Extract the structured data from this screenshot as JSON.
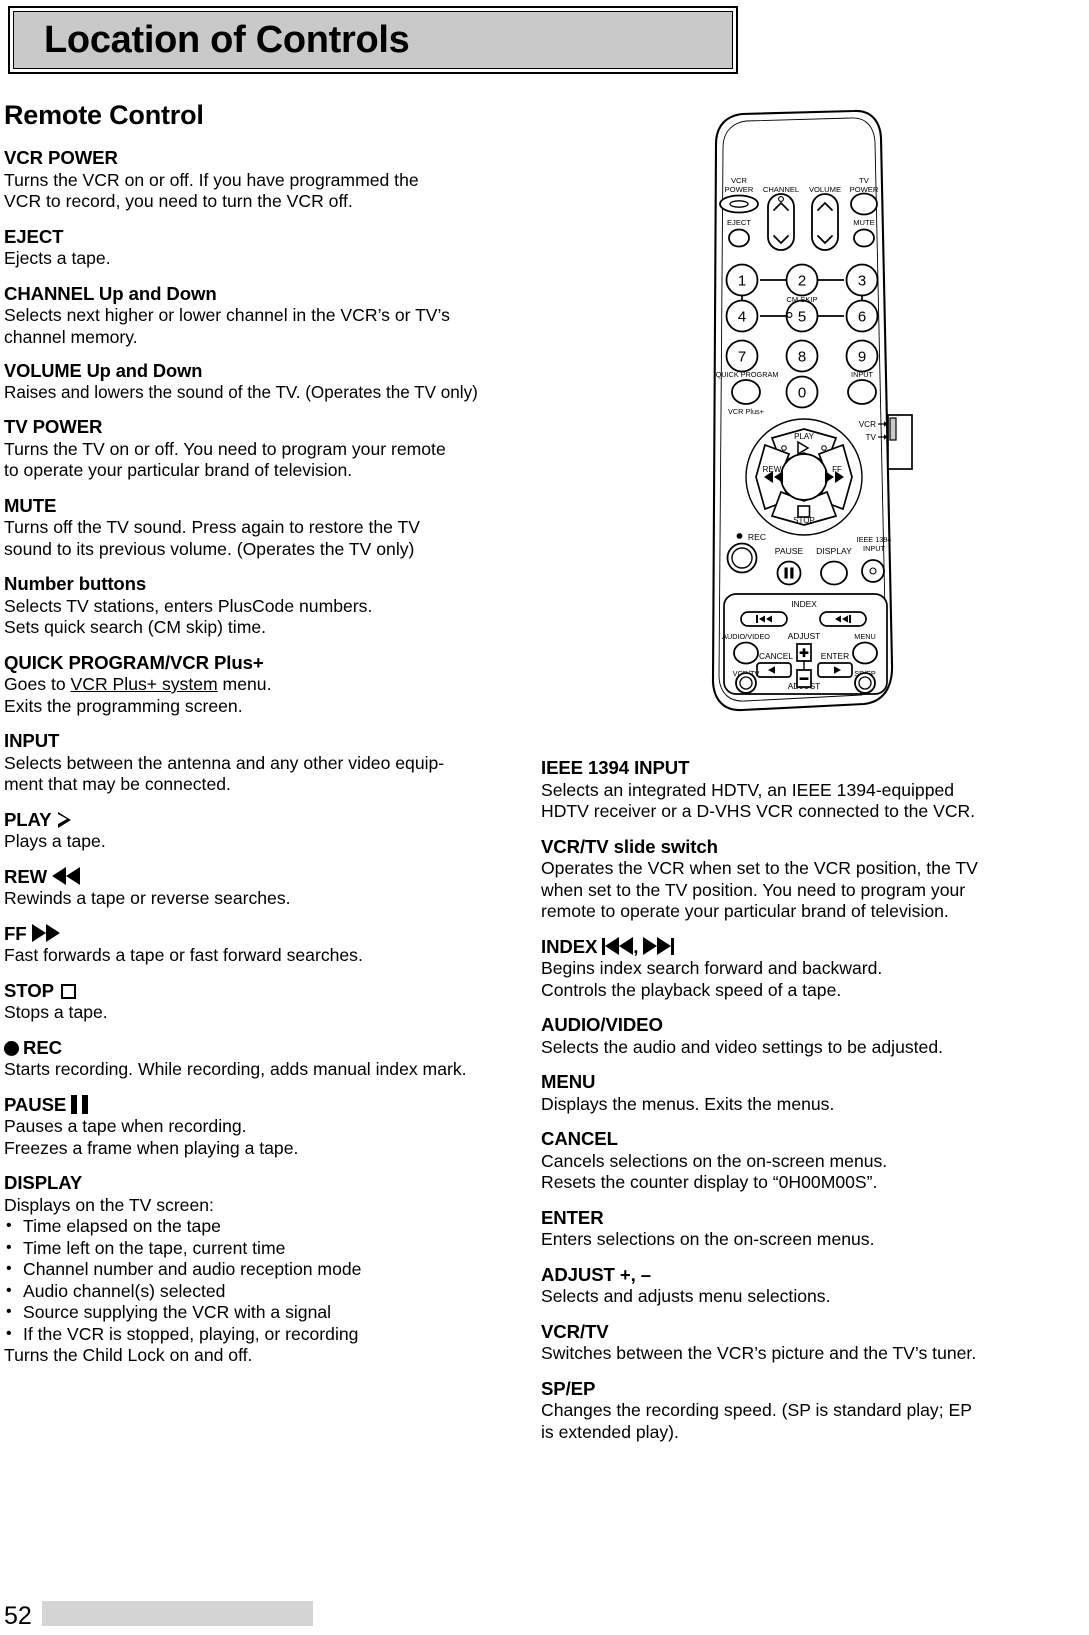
{
  "page": {
    "title": "Location of Controls",
    "section_heading": "Remote Control",
    "page_number": "52"
  },
  "left_column": [
    {
      "title": "VCR POWER",
      "lines": [
        "Turns the VCR on or off.  If you have programmed the",
        "VCR to record, you need to turn the VCR off."
      ]
    },
    {
      "title": "EJECT",
      "lines": [
        "Ejects a tape."
      ]
    },
    {
      "title": "CHANNEL Up and Down",
      "lines": [
        "Selects next higher or lower channel in the VCR’s or TV’s",
        "channel memory."
      ]
    },
    {
      "title": "VOLUME Up and Down",
      "lines": [
        "Raises and lowers the sound of the TV.  (Operates the TV only)"
      ]
    },
    {
      "title": "TV POWER",
      "lines": [
        "Turns the TV on or off.  You need to program your remote",
        "to operate your particular brand of television."
      ]
    },
    {
      "title": "MUTE",
      "lines": [
        "Turns off the TV sound.  Press again to restore the TV",
        "sound to its previous volume.  (Operates the TV only)"
      ]
    },
    {
      "title": "Number buttons",
      "lines": [
        "Selects TV stations, enters PlusCode numbers.",
        "Sets quick search (CM skip) time."
      ]
    },
    {
      "title": "QUICK PROGRAM/VCR Plus+",
      "lines_pre": "Goes to ",
      "lines_underlined": "VCR Plus+ system",
      "lines_post": " menu.",
      "lines": [
        "Exits the programming screen."
      ]
    },
    {
      "title": "INPUT",
      "lines": [
        "Selects between the antenna and any other video equip-",
        "ment that may be connected."
      ]
    },
    {
      "title": "PLAY",
      "icon": "play-triangle-outline-icon",
      "lines": [
        "Plays a tape."
      ]
    },
    {
      "title": "REW",
      "icon": "rewind-double-left-triangle-icon",
      "lines": [
        "Rewinds a tape or reverse searches."
      ]
    },
    {
      "title": "FF",
      "icon": "fast-forward-double-right-triangle-icon",
      "lines": [
        "Fast forwards a tape or fast forward searches."
      ]
    },
    {
      "title": "STOP",
      "icon": "stop-square-outline-icon",
      "lines": [
        "Stops a tape."
      ]
    },
    {
      "title": "REC",
      "icon": "record-filled-circle-icon",
      "icon_position": "before",
      "lines": [
        "Starts recording.  While recording, adds manual index mark."
      ]
    },
    {
      "title": "PAUSE",
      "icon": "pause-double-bar-icon",
      "lines": [
        "Pauses a tape when recording.",
        "Freezes a frame when playing a tape."
      ]
    },
    {
      "title": "DISPLAY",
      "lines": [
        "Displays on the TV screen:"
      ],
      "bullets": [
        "Time elapsed on the tape",
        "Time left on the tape, current time",
        "Channel number and audio reception mode",
        "Audio channel(s) selected",
        "Source supplying the VCR with a signal",
        "If the VCR is stopped, playing, or recording"
      ],
      "lines_after": [
        "Turns the Child Lock on and off."
      ]
    }
  ],
  "right_column": [
    {
      "title": "IEEE 1394 INPUT",
      "lines": [
        "Selects an integrated HDTV, an IEEE 1394-equipped",
        "HDTV receiver or a D-VHS VCR connected to the VCR."
      ]
    },
    {
      "title": "VCR/TV slide switch",
      "lines": [
        "Operates the VCR when set to the VCR position, the TV",
        "when set to the TV position.  You need to program your",
        "remote to operate your particular brand of television."
      ]
    },
    {
      "title": "INDEX",
      "icon": "index-search-backward-forward-icon",
      "lines": [
        "Begins index search forward and backward.",
        "Controls the playback speed of a tape."
      ]
    },
    {
      "title": "AUDIO/VIDEO",
      "lines": [
        "Selects the audio and video settings to be adjusted."
      ]
    },
    {
      "title": "MENU",
      "lines": [
        "Displays the menus.  Exits the menus."
      ]
    },
    {
      "title": "CANCEL",
      "lines": [
        "Cancels selections on the on-screen menus.",
        "Resets the counter display to “0H00M00S”."
      ]
    },
    {
      "title": "ENTER",
      "lines": [
        "Enters selections on the on-screen menus."
      ]
    },
    {
      "title": "ADJUST +, –",
      "lines": [
        "Selects and adjusts menu selections."
      ]
    },
    {
      "title": "VCR/TV",
      "lines": [
        "Switches between the VCR’s picture and the TV’s tuner."
      ]
    },
    {
      "title": "SP/EP",
      "lines": [
        "Changes the recording speed.  (SP is standard play; EP",
        "is extended play)."
      ]
    }
  ],
  "remote": {
    "labels": {
      "vcr_power_l1": "VCR",
      "vcr_power_l2": "POWER",
      "channel": "CHANNEL",
      "volume": "VOLUME",
      "tv_power_l1": "TV",
      "tv_power_l2": "POWER",
      "eject": "EJECT",
      "mute": "MUTE",
      "cm_skip": "CM SKIP",
      "quick_program": "QUICK PROGRAM",
      "input": "INPUT",
      "vcr_plus": "VCR Plus+",
      "play": "PLAY",
      "rew": "REW",
      "ff": "FF",
      "stop": "STOP",
      "rec": "REC",
      "pause": "PAUSE",
      "display": "DISPLAY",
      "ieee_l1": "IEEE 1394",
      "ieee_l2": "INPUT",
      "index": "INDEX",
      "audio_video": "AUDIO/VIDEO",
      "adjust_top": "ADJUST",
      "adjust_bottom": "ADJUST",
      "menu": "MENU",
      "cancel": "CANCEL",
      "enter": "ENTER",
      "vcr_tv": "VCR/TV",
      "sp_ep": "SP/EP",
      "slide_vcr": "VCR",
      "slide_tv": "TV",
      "plus": "+",
      "minus": "–"
    },
    "numbers": [
      "1",
      "2",
      "3",
      "4",
      "5",
      "6",
      "7",
      "8",
      "9",
      "0"
    ]
  },
  "colors": {
    "banner_fill": "#c9c9c9",
    "footer_bar": "#d4d4d4",
    "text": "#000000",
    "page_background": "#ffffff"
  }
}
